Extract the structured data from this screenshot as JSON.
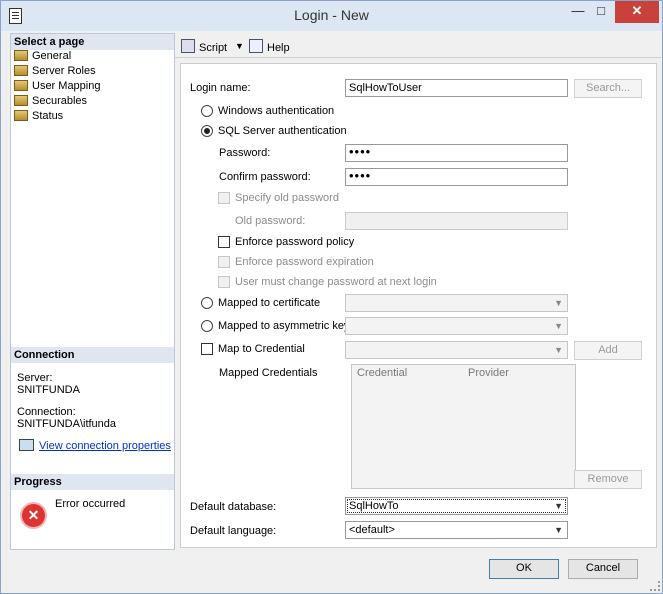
{
  "window": {
    "title": "Login - New"
  },
  "left": {
    "select_page": "Select a page",
    "pages": [
      "General",
      "Server Roles",
      "User Mapping",
      "Securables",
      "Status"
    ],
    "connection_title": "Connection",
    "server_label": "Server:",
    "server_value": "SNITFUNDA",
    "connection_label": "Connection:",
    "connection_value": "SNITFUNDA\\itfunda",
    "view_props": "View connection properties",
    "progress_title": "Progress",
    "progress_status": "Error occurred"
  },
  "toolbar": {
    "script": "Script",
    "help": "Help"
  },
  "form": {
    "login_name_label": "Login name:",
    "login_name_value": "SqlHowToUser",
    "search_button": "Search...",
    "windows_auth": "Windows authentication",
    "sql_auth": "SQL Server authentication",
    "password_label": "Password:",
    "password_value": "••••",
    "confirm_label": "Confirm password:",
    "confirm_value": "••••",
    "specify_old": "Specify old password",
    "old_password_label": "Old password:",
    "enforce_policy": "Enforce password policy",
    "enforce_expiration": "Enforce password expiration",
    "must_change": "User must change password at next login",
    "mapped_cert": "Mapped to certificate",
    "mapped_asym": "Mapped to asymmetric key",
    "map_credential": "Map to Credential",
    "add_button": "Add",
    "mapped_credentials": "Mapped Credentials",
    "col_credential": "Credential",
    "col_provider": "Provider",
    "remove_button": "Remove",
    "default_db_label": "Default database:",
    "default_db_value": "SqlHowTo",
    "default_lang_label": "Default language:",
    "default_lang_value": "<default>"
  },
  "footer": {
    "ok": "OK",
    "cancel": "Cancel"
  }
}
